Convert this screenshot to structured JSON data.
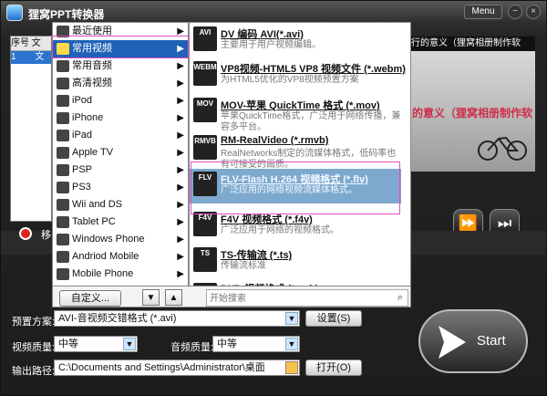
{
  "app": {
    "title": "狸窝PPT转换器",
    "menu": "Menu"
  },
  "left_list": {
    "headers": [
      "序号",
      "文"
    ],
    "row": {
      "no": "1",
      "name": "文"
    }
  },
  "preview": {
    "top_text": "行的意义（狸窝相册制作软",
    "overlay_text": "的意义（狸窝相册制作软"
  },
  "status": {
    "label": "移"
  },
  "categories": [
    {
      "label": "最近使用",
      "icon": "clock-icon"
    },
    {
      "label": "常用视频",
      "icon": "video-icon"
    },
    {
      "label": "常用音频",
      "icon": "audio-icon"
    },
    {
      "label": "高清视频",
      "icon": "hd-icon"
    },
    {
      "label": "iPod",
      "icon": "ipod-icon"
    },
    {
      "label": "iPhone",
      "icon": "iphone-icon"
    },
    {
      "label": "iPad",
      "icon": "ipad-icon"
    },
    {
      "label": "Apple TV",
      "icon": "apple-tv-icon"
    },
    {
      "label": "PSP",
      "icon": "psp-icon"
    },
    {
      "label": "PS3",
      "icon": "ps3-icon"
    },
    {
      "label": "Wii and DS",
      "icon": "wii-icon"
    },
    {
      "label": "Tablet PC",
      "icon": "tablet-icon"
    },
    {
      "label": "Windows Phone",
      "icon": "windows-phone-icon"
    },
    {
      "label": "Andriod Mobile",
      "icon": "android-icon"
    },
    {
      "label": "Mobile Phone",
      "icon": "mobile-icon"
    }
  ],
  "formats": [
    {
      "icon": "AVI",
      "title": "DV 编码 AVI(*.avi)",
      "desc": "主要用于用户视频编辑。"
    },
    {
      "icon": "WEBM",
      "title": "VP8视频-HTML5 VP8 视频文件 (*.webm)",
      "desc": "为HTML5优化的VP8视频预置方案"
    },
    {
      "icon": "MOV",
      "title": "MOV-苹果 QuickTime 格式 (*.mov)",
      "desc": "苹果QuickTime格式，广泛用于网络传播，兼容多平台。"
    },
    {
      "icon": "RMVB",
      "title": "RM-RealVideo (*.rmvb)",
      "desc": "RealNetworks制定的流媒体格式，低码率也有可接受的画质。"
    },
    {
      "icon": "FLV",
      "title": "FLV-Flash H.264 视频格式 (*.flv)",
      "desc": "广泛应用的网络视频流媒体格式。"
    },
    {
      "icon": "F4V",
      "title": "F4V 视频格式 (*.f4v)",
      "desc": "广泛应用于网络的视频格式。"
    },
    {
      "icon": "TS",
      "title": "TS-传输流 (*.ts)",
      "desc": "传输流标准"
    },
    {
      "icon": "DVD",
      "title": "DVD 视频格式 (*.vob)",
      "desc": ""
    }
  ],
  "footer": {
    "custom": "自定义...",
    "search_placeholder": "开始搜索"
  },
  "form": {
    "preset_label": "预置方案:",
    "preset_value": "AVI-音视频交错格式 (*.avi)",
    "settings_button": "设置(S)",
    "video_quality_label": "视频质量:",
    "video_quality_value": "中等",
    "audio_quality_label": "音频质量:",
    "audio_quality_value": "中等",
    "output_label": "输出路径:",
    "output_value": "C:\\Documents and Settings\\Administrator\\桌面",
    "open_button": "打开(O)"
  },
  "start": {
    "label": "Start"
  }
}
